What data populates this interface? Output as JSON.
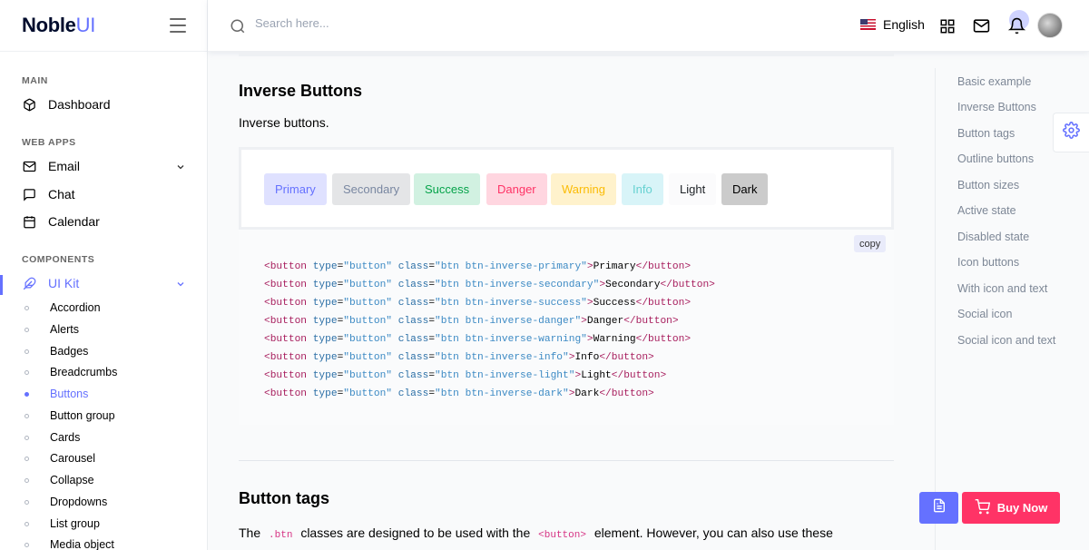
{
  "brand": {
    "name_main": "Noble",
    "name_accent": "UI"
  },
  "sidebar": {
    "categories": [
      "MAIN",
      "WEB APPS",
      "COMPONENTS"
    ],
    "items": [
      {
        "label": "Dashboard",
        "icon": "box-icon"
      },
      {
        "label": "Email",
        "icon": "mail-icon"
      },
      {
        "label": "Chat",
        "icon": "message-square-icon"
      },
      {
        "label": "Calendar",
        "icon": "calendar-icon"
      },
      {
        "label": "UI Kit",
        "icon": "feather-icon"
      }
    ],
    "ui_kit_items": [
      "Accordion",
      "Alerts",
      "Badges",
      "Breadcrumbs",
      "Buttons",
      "Button group",
      "Cards",
      "Carousel",
      "Collapse",
      "Dropdowns",
      "List group",
      "Media object"
    ],
    "active_sub": "Buttons"
  },
  "topbar": {
    "search_placeholder": "Search here...",
    "language": "English"
  },
  "main": {
    "section_title": "Inverse Buttons",
    "section_desc": "Inverse buttons.",
    "demo_buttons": [
      "Primary",
      "Secondary",
      "Success",
      "Danger",
      "Warning",
      "Info",
      "Light",
      "Dark"
    ],
    "copy_label": "copy",
    "code_lines": [
      {
        "cls": "btn btn-inverse-primary",
        "text": "Primary"
      },
      {
        "cls": "btn btn-inverse-secondary",
        "text": "Secondary"
      },
      {
        "cls": "btn btn-inverse-success",
        "text": "Success"
      },
      {
        "cls": "btn btn-inverse-danger",
        "text": "Danger"
      },
      {
        "cls": "btn btn-inverse-warning",
        "text": "Warning"
      },
      {
        "cls": "btn btn-inverse-info",
        "text": "Info"
      },
      {
        "cls": "btn btn-inverse-light",
        "text": "Light"
      },
      {
        "cls": "btn btn-inverse-dark",
        "text": "Dark"
      }
    ],
    "section2_title": "Button tags",
    "section2_p1": "The",
    "section2_code1": ".btn",
    "section2_p2": "classes are designed to be used with the",
    "section2_code2": "<button>",
    "section2_p3": "element. However, you can also use these"
  },
  "toc": [
    "Basic example",
    "Inverse Buttons",
    "Button tags",
    "Outline buttons",
    "Button sizes",
    "Active state",
    "Disabled state",
    "Icon buttons",
    "With icon and text",
    "Social icon",
    "Social icon and text"
  ],
  "floating": {
    "buy_label": "Buy Now"
  },
  "colors": {
    "accent": "#6571ff",
    "buy": "#ff3366"
  }
}
